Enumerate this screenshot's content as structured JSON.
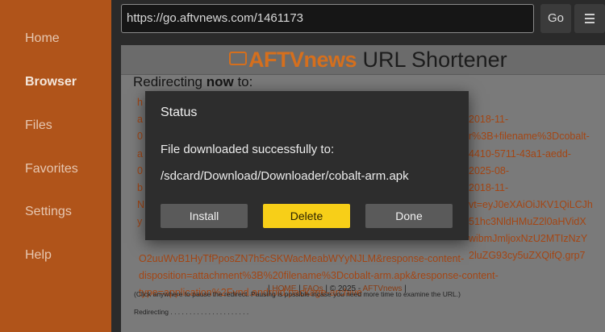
{
  "sidebar": {
    "items": [
      {
        "label": "Home"
      },
      {
        "label": "Browser"
      },
      {
        "label": "Files"
      },
      {
        "label": "Favorites"
      },
      {
        "label": "Settings"
      },
      {
        "label": "Help"
      }
    ],
    "active": "Browser"
  },
  "toolbar": {
    "url": "https://go.aftvnews.com/1461173",
    "go_label": "Go",
    "menu_icon": "hamburger-menu-icon"
  },
  "page": {
    "logo_brand": "AFTVnews",
    "logo_suffix": " URL Shortener",
    "redirect_prefix": "Redirecting ",
    "redirect_bold": "now",
    "redirect_suffix": " to:",
    "link_lines": [
      "h",
      "a",
      "0",
      "a",
      "0",
      "b",
      "N",
      "y",
      "2018-11-",
      "r%3B+filename%3Dcobalt-",
      "4410-5711-43a1-aedd-",
      "2025-08-",
      "2018-11-",
      "vt=eyJ0eXAiOiJKV1QiLCJh",
      "51hc3NldHMuZ2l0aHVidX",
      "wibmJmljoxNzU2MTIzNzY",
      "2luZG93cy5uZXQifQ.grp7",
      "O2uuWvB1HyTfPposZN7h5cSKWacMeabWYyNJLM&response-content-",
      "disposition=attachment%3B%20filename%3Dcobalt-arm.apk&response-content-",
      "type=application%2Fvnd.android.package-archive"
    ],
    "footer_home": "HOME",
    "footer_faqs": "FAQs",
    "footer_copyright": "© 2025 -",
    "footer_aftvnews": "AFTVnews",
    "pause_note": "(Click anywhere to pause the redirect. Pausing is possible incase you need more time to examine the URL.)",
    "redirecting_dots": "Redirecting . . . . . . . . . . . . . . . . . . . . ."
  },
  "dialog": {
    "title": "Status",
    "message": "File downloaded successfully to:",
    "path": "/sdcard/Download/Downloader/cobalt-arm.apk",
    "install_label": "Install",
    "delete_label": "Delete",
    "done_label": "Done"
  },
  "colors": {
    "sidebar_bg": "#b0541a",
    "accent": "#d56f1d",
    "delete_button": "#f7cf18",
    "link_text": "#a44614"
  }
}
